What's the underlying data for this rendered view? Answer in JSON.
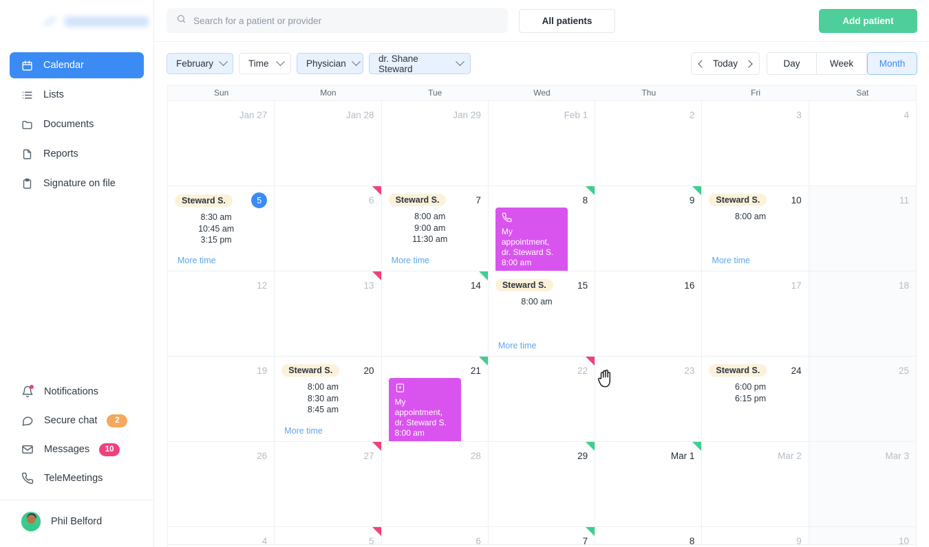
{
  "sidebar": {
    "logo_text": "EHR SYSTEMS",
    "nav_items": [
      {
        "label": "Calendar",
        "icon": "calendar-icon",
        "active": true
      },
      {
        "label": "Lists",
        "icon": "list-icon",
        "active": false
      },
      {
        "label": "Documents",
        "icon": "folder-icon",
        "active": false
      },
      {
        "label": "Reports",
        "icon": "file-icon",
        "active": false
      },
      {
        "label": "Signature on file",
        "icon": "clipboard-icon",
        "active": false
      }
    ],
    "bottom_items": [
      {
        "label": "Notifications",
        "icon": "bell-icon",
        "badge": null,
        "dot": true
      },
      {
        "label": "Secure chat",
        "icon": "chat-icon",
        "badge": "2",
        "badge_color": "orange"
      },
      {
        "label": "Messages",
        "icon": "envelope-icon",
        "badge": "10",
        "badge_color": "pink"
      },
      {
        "label": "TeleMeetings",
        "icon": "phone-icon",
        "badge": null
      }
    ],
    "user": {
      "name": "Phil Belford"
    }
  },
  "topbar": {
    "search_placeholder": "Search for a patient or provider",
    "search_value": "",
    "all_patients_label": "All patients",
    "add_patient_label": "Add patient"
  },
  "filters": {
    "month": "February",
    "time": "Time",
    "role": "Physician",
    "provider": "dr. Shane Steward",
    "today_label": "Today",
    "views": [
      {
        "label": "Day",
        "active": false
      },
      {
        "label": "Week",
        "active": false
      },
      {
        "label": "Month",
        "active": true
      }
    ]
  },
  "calendar": {
    "dow": [
      "Sun",
      "Mon",
      "Tue",
      "Wed",
      "Thu",
      "Fri",
      "Sat"
    ],
    "more_time_label": "More time",
    "weeks": [
      [
        {
          "day": "Jan 27",
          "muted": true,
          "weekend": false
        },
        {
          "day": "Jan 28",
          "muted": true,
          "weekend": false
        },
        {
          "day": "Jan 29",
          "muted": true,
          "weekend": false
        },
        {
          "day": "Feb 1",
          "muted": true,
          "weekend": false
        },
        {
          "day": "2",
          "muted": true,
          "weekend": false
        },
        {
          "day": "3",
          "muted": true,
          "weekend": false
        },
        {
          "day": "4",
          "muted": true,
          "weekend": false
        }
      ],
      [
        {
          "day": "5",
          "today": true,
          "chip": "Steward S.",
          "times": [
            "8:30 am",
            "10:45 am",
            "3:15 pm"
          ],
          "more": true
        },
        {
          "day": "6",
          "muted": true,
          "tri": "pink"
        },
        {
          "day": "7",
          "chip": "Steward S.",
          "times": [
            "8:00 am",
            "9:00 am",
            "11:30 am"
          ],
          "more": true
        },
        {
          "day": "8",
          "tri": "green",
          "appt": {
            "icon": "phone-icon",
            "title": "My appointment,",
            "doctor": "dr. Steward S.",
            "time": "8:00 am"
          }
        },
        {
          "day": "9",
          "tri": "green"
        },
        {
          "day": "10",
          "chip": "Steward S.",
          "times": [
            "8:00 am"
          ],
          "more": true
        },
        {
          "day": "11",
          "muted": true,
          "weekend": true
        }
      ],
      [
        {
          "day": "12",
          "muted": true
        },
        {
          "day": "13",
          "muted": true,
          "tri": "pink"
        },
        {
          "day": "14",
          "tri": "green"
        },
        {
          "day": "15",
          "chip": "Steward S.",
          "times": [
            "8:00 am"
          ],
          "more": true
        },
        {
          "day": "16"
        },
        {
          "day": "17",
          "muted": true
        },
        {
          "day": "18",
          "muted": true,
          "weekend": true
        }
      ],
      [
        {
          "day": "19",
          "muted": true
        },
        {
          "day": "20",
          "chip": "Steward S.",
          "times": [
            "8:00 am",
            "8:30 am",
            "8:45 am"
          ],
          "more": true
        },
        {
          "day": "21",
          "tri": "green",
          "appt": {
            "icon": "hospital-icon",
            "title": "My appointment,",
            "doctor": "dr. Steward S.",
            "time": "8:00 am"
          }
        },
        {
          "day": "22",
          "muted": true,
          "tri": "pink"
        },
        {
          "day": "23",
          "muted": true
        },
        {
          "day": "24",
          "chip": "Steward S.",
          "times": [
            "6:00 pm",
            "6:15 pm"
          ]
        },
        {
          "day": "25",
          "muted": true,
          "weekend": true
        }
      ],
      [
        {
          "day": "26",
          "muted": true
        },
        {
          "day": "27",
          "muted": true,
          "tri": "pink"
        },
        {
          "day": "28",
          "muted": true
        },
        {
          "day": "29",
          "tri": "green"
        },
        {
          "day": "Mar 1",
          "tri": "green"
        },
        {
          "day": "Mar 2",
          "muted": true
        },
        {
          "day": "Mar 3",
          "muted": true,
          "weekend": true
        }
      ],
      [
        {
          "day": "4",
          "muted": true
        },
        {
          "day": "5",
          "muted": true,
          "tri": "pink"
        },
        {
          "day": "6",
          "muted": true
        },
        {
          "day": "7",
          "tri": "green"
        },
        {
          "day": "8"
        },
        {
          "day": "9",
          "muted": true
        },
        {
          "day": "10",
          "muted": true,
          "weekend": true
        }
      ]
    ]
  },
  "colors": {
    "accent_blue": "#3b8bf5",
    "green": "#4ece9a",
    "purple": "#d954ee",
    "chip_yellow": "#fcf2d9",
    "tri_pink": "#f0427a",
    "tri_green": "#3ece8f"
  }
}
